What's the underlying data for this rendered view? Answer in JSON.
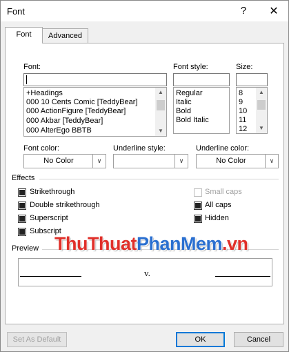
{
  "window": {
    "title": "Font",
    "help_glyph": "?",
    "close_glyph": "✕"
  },
  "tabs": [
    {
      "label": "Font",
      "active": true
    },
    {
      "label": "Advanced",
      "active": false
    }
  ],
  "font": {
    "label": "Font:",
    "value": "",
    "items": [
      "+Headings",
      "000 10 Cents Comic [TeddyBear]",
      "000 ActionFigure [TeddyBear]",
      "000 Akbar [TeddyBear]",
      "000 AlterEgo BBTB"
    ]
  },
  "font_style": {
    "label": "Font style:",
    "items": [
      "Regular",
      "Italic",
      "Bold",
      "Bold Italic"
    ]
  },
  "size": {
    "label": "Size:",
    "items": [
      "8",
      "9",
      "10",
      "11",
      "12"
    ]
  },
  "font_color": {
    "label": "Font color:",
    "value": "No Color"
  },
  "underline_style": {
    "label": "Underline style:",
    "value": ""
  },
  "underline_color": {
    "label": "Underline color:",
    "value": "No Color"
  },
  "effects": {
    "title": "Effects",
    "strikethrough": "Strikethrough",
    "double_strikethrough": "Double strikethrough",
    "superscript": "Superscript",
    "subscript": "Subscript",
    "small_caps": "Small caps",
    "all_caps": "All caps",
    "hidden": "Hidden"
  },
  "preview": {
    "title": "Preview",
    "sample": "v."
  },
  "watermark": {
    "part1": "ThuThuat",
    "part2": "PhanMem",
    "part3": ".vn"
  },
  "buttons": {
    "set_default": "Set As Default",
    "ok": "OK",
    "cancel": "Cancel"
  },
  "icons": {
    "scroll_up": "▲",
    "scroll_down": "▼",
    "combo_arrow": "∨"
  }
}
